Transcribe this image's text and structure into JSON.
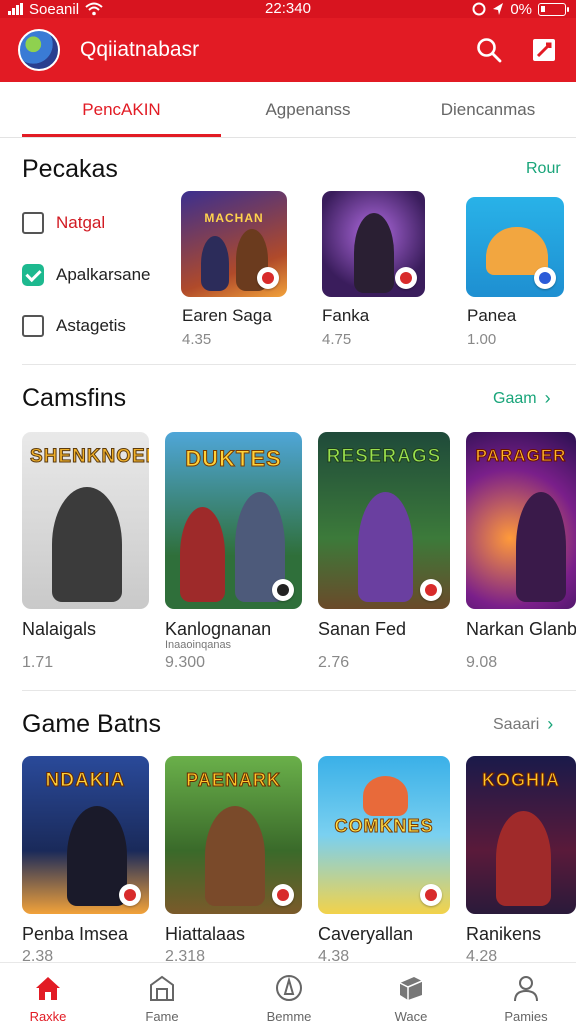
{
  "status_bar": {
    "carrier": "Soeanil",
    "time": "22:340",
    "battery": "0%"
  },
  "app_bar": {
    "title": "Qqiiatnabasr",
    "logo_icon": "app-logo-icon",
    "search_icon": "search-icon",
    "action_icon": "edit-icon"
  },
  "tabs": [
    {
      "label": "PencAKIN",
      "active": true
    },
    {
      "label": "Agpenanss",
      "active": false
    },
    {
      "label": "Diencanmas",
      "active": false
    }
  ],
  "section1": {
    "title": "Pecakas",
    "link": "Rour",
    "filters": [
      {
        "label": "Natgal",
        "checked": false
      },
      {
        "label": "Apalkarsane",
        "checked": true
      },
      {
        "label": "Astagetis",
        "checked": false
      }
    ],
    "apps": [
      {
        "name": "Earen Saga",
        "rating": "4.35",
        "tile_title": "MACHAN"
      },
      {
        "name": "Fanka",
        "rating": "4.75",
        "tile_title": ""
      },
      {
        "name": "Panea",
        "rating": "1.00",
        "tile_title": ""
      }
    ]
  },
  "section2": {
    "title": "Camsfins",
    "link": "Gaam",
    "games": [
      {
        "name": "Nalaigals",
        "sub": "",
        "rating": "1.71",
        "tile_title": "SHENKNOER"
      },
      {
        "name": "Kanlognanan",
        "sub": "Inaaoinqanas",
        "rating": "9.300",
        "tile_title": "DUKTES"
      },
      {
        "name": "Sanan Fed",
        "sub": "",
        "rating": "2.76",
        "tile_title": "RESERAGS"
      },
      {
        "name": "Narkan Glanba",
        "sub": "",
        "rating": "9.08",
        "tile_title": "PARAGER"
      }
    ]
  },
  "section3": {
    "title": "Game Batns",
    "link": "Saaari",
    "games": [
      {
        "name": "Penba Imsea",
        "rating": "2.38",
        "tile_title": "NDAKIA"
      },
      {
        "name": "Hiattalaas",
        "rating": "2.318",
        "tile_title": "PAENARK"
      },
      {
        "name": "Caveryallan",
        "rating": "4.38",
        "tile_title": "COMKNES"
      },
      {
        "name": "Ranikens",
        "rating": "4.28",
        "tile_title": "KOGHIA"
      }
    ]
  },
  "bottom_nav": [
    {
      "label": "Raxke",
      "icon": "home-icon",
      "active": true
    },
    {
      "label": "Fame",
      "icon": "store-icon",
      "active": false
    },
    {
      "label": "Bemme",
      "icon": "person-circle-icon",
      "active": false
    },
    {
      "label": "Wace",
      "icon": "box-icon",
      "active": false
    },
    {
      "label": "Pamies",
      "icon": "profile-icon",
      "active": false
    }
  ],
  "colors": {
    "brand_red": "#e21b24",
    "accent_green": "#19a57a"
  }
}
